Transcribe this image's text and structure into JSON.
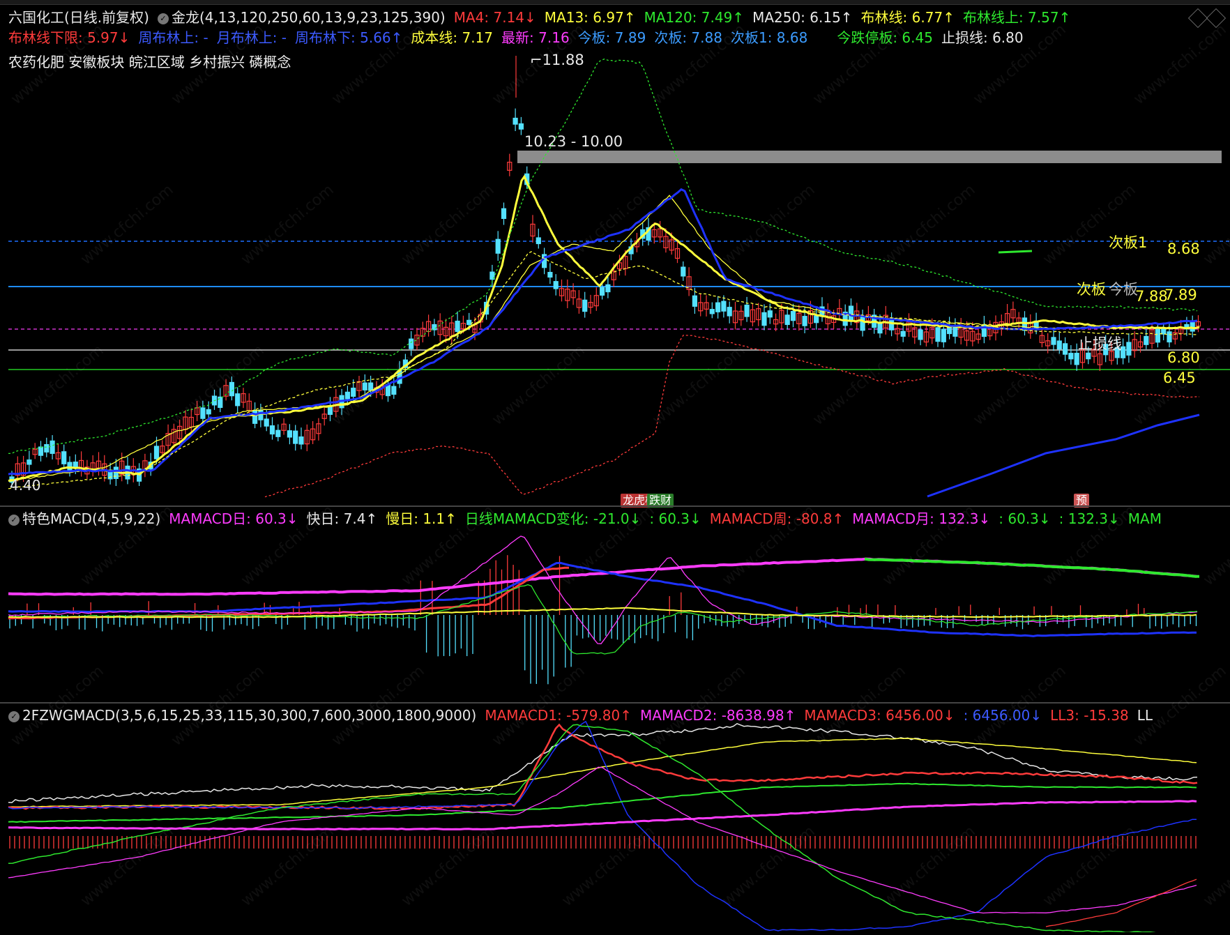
{
  "header": {
    "stock": "六国化工(日线.前复权)",
    "formula": "金龙(4,13,120,250,60,13,9,23,125,390)",
    "ma4": "MA4: 7.14↓",
    "ma13": "MA13: 6.97↑",
    "ma120": "MA120: 7.49↑",
    "ma250": "MA250: 6.15↑",
    "boll": "布林线: 6.77↑",
    "boll_up": "布林线上: 7.57↑",
    "boll_low": "布林线下限: 5.97↓",
    "week_boll_up": "周布林上: -",
    "month_boll_up": "月布林上: -",
    "week_boll_low": "周布林下: 5.66↑",
    "cost_line": "成本线: 7.17",
    "latest": "最新: 7.16",
    "today_board": "今板: 7.89",
    "next_board": "次板: 7.88",
    "next_board1": "次板1: 8.68",
    "today_limit_down": "今跌停板: 6.45",
    "stop_loss": "止损线: 6.80"
  },
  "concepts": "农药化肥 安徽板块  皖江区域 乡村振兴 磷概念",
  "price_labels": {
    "high": "11.88",
    "low": "4.40",
    "zone": "10.23 - 10.00",
    "next_board1_label": "次板1",
    "next_board1_val": "8.68",
    "next_board_label": "次板",
    "today_board_label": "今板",
    "next_board_val": "7.88",
    "today_board_val": "7.89",
    "stop_loss_label": "止损线",
    "stop_loss_val": "6.80",
    "limit_down_val": "6.45"
  },
  "markers": {
    "m1": "龙虎榜",
    "m2": "跌财",
    "m3": "预"
  },
  "panel2": {
    "title": "特色MACD(4,5,9,22)",
    "v1": "MAMACD日: 60.3↓",
    "v2": "快日: 7.4↑",
    "v3": "慢日: 1.1↑",
    "v4": "日线MAMACD变化: -21.0↓",
    "v5": ": 60.3↓",
    "v6": "MAMACD周: -80.8↑",
    "v7": "MAMACD月: 132.3↓",
    "v8": ": 60.3↓",
    "v9": ": 132.3↓",
    "v10": "MAM"
  },
  "panel3": {
    "title": "2FZWGMACD(3,5,6,15,25,33,115,30,300,7,600,3000,1800,9000)",
    "v1": "MAMACD1: -579.80↑",
    "v2": "MAMACD2: -8638.98↑",
    "v3": "MAMACD3: 6456.00↓",
    "v4": ": 6456.00↓",
    "v5": "LL3: -15.38",
    "v6": "LL"
  },
  "watermark": "www.cfchi.com",
  "colors": {
    "red": "#ff3b3b",
    "cyan": "#54e1ff",
    "yellow": "#ffff3c",
    "blue": "#1e32ff",
    "green": "#2ee82e",
    "magenta": "#ff3cff",
    "white": "#e8e8e8"
  }
}
